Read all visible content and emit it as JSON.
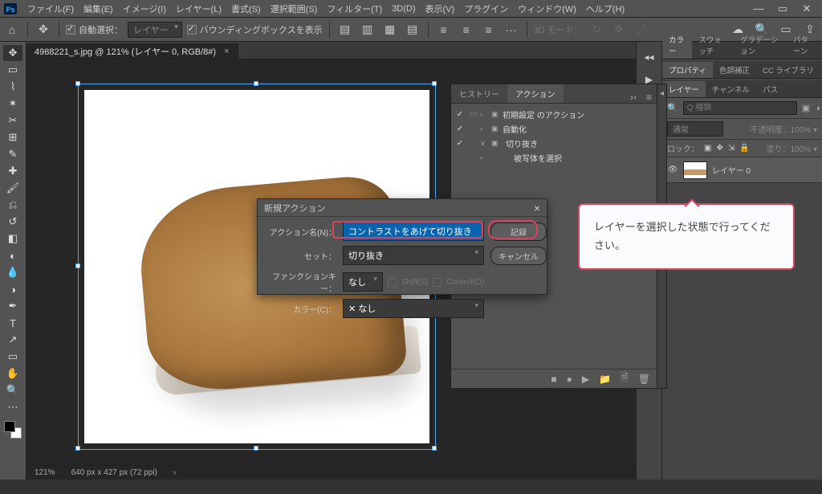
{
  "menu": {
    "items": [
      "ファイル(F)",
      "編集(E)",
      "イメージ(I)",
      "レイヤー(L)",
      "書式(S)",
      "選択範囲(S)",
      "フィルター(T)",
      "3D(D)",
      "表示(V)",
      "プラグイン",
      "ウィンドウ(W)",
      "ヘルプ(H)"
    ]
  },
  "options": {
    "autoselect_label": "自動選択：",
    "autoselect_target": "レイヤー",
    "boundingbox_label": "バウンディングボックスを表示",
    "mode3d_label": "3D モード："
  },
  "doc": {
    "tab": "4988221_s.jpg @ 121% (レイヤー 0, RGB/8#)",
    "zoom": "121%",
    "dims": "640 px x 427 px (72 ppi)"
  },
  "actions_panel": {
    "tab_history": "ヒストリー",
    "tab_actions": "アクション",
    "items": [
      {
        "label": "初期設定 のアクション",
        "folder": true,
        "open": false
      },
      {
        "label": "自動化",
        "folder": true,
        "open": false
      },
      {
        "label": "切り抜き",
        "folder": true,
        "open": true
      },
      {
        "label": "被写体を選択",
        "folder": false,
        "indent": true
      }
    ],
    "footer_icons": [
      "■",
      "●",
      "▶",
      "📁",
      "🗎",
      "🗑"
    ]
  },
  "right": {
    "color_tabs": [
      "カラー",
      "スウォッチ",
      "グラデーション",
      "パターン"
    ],
    "prop_tabs": [
      "プロパティ",
      "色調補正",
      "CC ライブラリ"
    ],
    "layer_tabs": [
      "レイヤー",
      "チャンネル",
      "パス"
    ],
    "search_placeholder": "Q 種類",
    "blend_mode": "通常",
    "opacity_label": "不透明度：",
    "opacity_value": "100%",
    "lock_label": "ロック：",
    "fill_label": "塗り：",
    "fill_value": "100%",
    "layer0": "レイヤー 0"
  },
  "dialog": {
    "title": "新規アクション",
    "name_label": "アクション名(N)：",
    "name_value": "コントラストをあげて切り抜き",
    "set_label": "セット：",
    "set_value": "切り抜き",
    "fkey_label": "ファンクションキー：",
    "fkey_value": "なし",
    "shift_label": "Shift(S)",
    "ctrl_label": "Control(O)",
    "color_label": "カラー(C)：",
    "color_value": "✕ なし",
    "record_btn": "記録",
    "cancel_btn": "キャンセル"
  },
  "callout": {
    "text": "レイヤーを選択した状態で行ってください。"
  }
}
